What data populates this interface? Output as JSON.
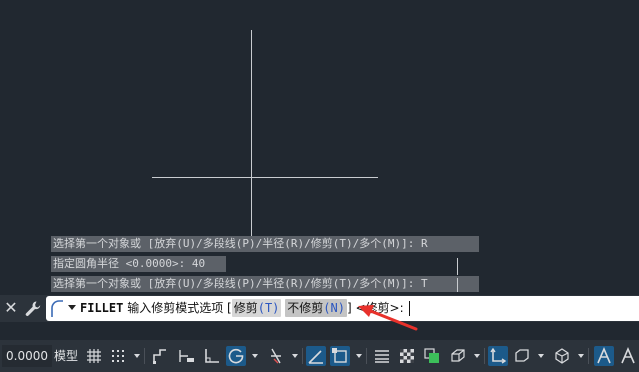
{
  "history": {
    "line1": "选择第一个对象或 [放弃(U)/多段线(P)/半径(R)/修剪(T)/多个(M)]: R",
    "line2": "指定圆角半径 <0.0000>: 40",
    "line3": "选择第一个对象或 [放弃(U)/多段线(P)/半径(R)/修剪(T)/多个(M)]: T"
  },
  "command": {
    "name": "FILLET",
    "prompt": "输入修剪模式选项",
    "bracket_open": "[",
    "option1_label": "修剪",
    "option1_key": "(T)",
    "option2_label": "不修剪",
    "option2_key": "(N)",
    "bracket_close": "]",
    "default_text": "<修剪>:",
    "close_symbol": "✕"
  },
  "status": {
    "coordinate": "0.0000",
    "model_label": "模型"
  },
  "colors": {
    "canvas": "#212830",
    "history_bg": "#5c6168",
    "option_key": "#2a55c0",
    "arrow": "#e8312b",
    "active_toggle": "#1c5a8a"
  },
  "icons": [
    "close-icon",
    "wrench-icon",
    "fillet-curve-icon",
    "grid-icon",
    "snap-icon",
    "infer-constraints-icon",
    "dynamic-input-icon",
    "ortho-icon",
    "polar-tracking-icon",
    "isometric-icon",
    "object-snap-tracking-icon",
    "object-snap-icon",
    "lineweight-icon",
    "transparency-icon",
    "selection-cycling-icon",
    "3d-object-snap-icon",
    "ucs-icon",
    "annotation-monitor-icon",
    "units-icon",
    "quick-properties-icon",
    "annotation-scale-icon"
  ]
}
